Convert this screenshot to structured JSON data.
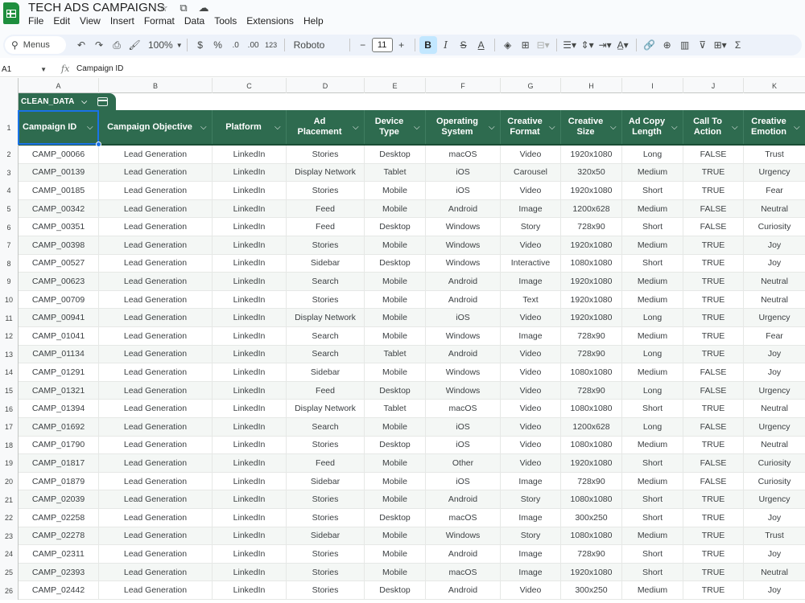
{
  "app": {
    "title": "TECH ADS CAMPAIGNS",
    "menu": [
      "File",
      "Edit",
      "View",
      "Insert",
      "Format",
      "Data",
      "Tools",
      "Extensions",
      "Help"
    ],
    "title_icons": [
      "star-icon",
      "move-folder-icon",
      "cloud-status-icon"
    ]
  },
  "toolbar": {
    "menus_label": "Menus",
    "zoom": "100%",
    "currency": "$",
    "percent": "%",
    "decrease_decimal": ".0",
    "increase_decimal": ".00",
    "more_formats": "123",
    "font": "Roboto",
    "font_size": "11",
    "bold": "B",
    "italic": "I",
    "strike": "S",
    "text_color": "A",
    "sigma": "Σ"
  },
  "formula_bar": {
    "name_box": "A1",
    "fx": "fx",
    "content": "Campaign ID"
  },
  "grid": {
    "column_letters": [
      "A",
      "B",
      "C",
      "D",
      "E",
      "F",
      "G",
      "H",
      "I",
      "J",
      "K"
    ],
    "table_name": "CLEAN_DATA",
    "headers": [
      "Campaign ID",
      "Campaign Objective",
      "Platform",
      "Ad\nPlacement",
      "Device\nType",
      "Operating\nSystem",
      "Creative\nFormat",
      "Creative\nSize",
      "Ad Copy\nLength",
      "Call To\nAction",
      "Creative\nEmotion"
    ],
    "row_numbers": [
      "1",
      "2",
      "3",
      "4",
      "5",
      "6",
      "7",
      "8",
      "9",
      "10",
      "11",
      "12",
      "13",
      "14",
      "15",
      "16",
      "17",
      "18",
      "19",
      "20",
      "21",
      "22",
      "23",
      "24",
      "25",
      "26"
    ],
    "rows": [
      [
        "CAMP_00066",
        "Lead Generation",
        "LinkedIn",
        "Stories",
        "Desktop",
        "macOS",
        "Video",
        "1920x1080",
        "Long",
        "FALSE",
        "Trust"
      ],
      [
        "CAMP_00139",
        "Lead Generation",
        "LinkedIn",
        "Display Network",
        "Tablet",
        "iOS",
        "Carousel",
        "320x50",
        "Medium",
        "TRUE",
        "Urgency"
      ],
      [
        "CAMP_00185",
        "Lead Generation",
        "LinkedIn",
        "Stories",
        "Mobile",
        "iOS",
        "Video",
        "1920x1080",
        "Short",
        "TRUE",
        "Fear"
      ],
      [
        "CAMP_00342",
        "Lead Generation",
        "LinkedIn",
        "Feed",
        "Mobile",
        "Android",
        "Image",
        "1200x628",
        "Medium",
        "FALSE",
        "Neutral"
      ],
      [
        "CAMP_00351",
        "Lead Generation",
        "LinkedIn",
        "Feed",
        "Desktop",
        "Windows",
        "Story",
        "728x90",
        "Short",
        "FALSE",
        "Curiosity"
      ],
      [
        "CAMP_00398",
        "Lead Generation",
        "LinkedIn",
        "Stories",
        "Mobile",
        "Windows",
        "Video",
        "1920x1080",
        "Medium",
        "TRUE",
        "Joy"
      ],
      [
        "CAMP_00527",
        "Lead Generation",
        "LinkedIn",
        "Sidebar",
        "Desktop",
        "Windows",
        "Interactive",
        "1080x1080",
        "Short",
        "TRUE",
        "Joy"
      ],
      [
        "CAMP_00623",
        "Lead Generation",
        "LinkedIn",
        "Search",
        "Mobile",
        "Android",
        "Image",
        "1920x1080",
        "Medium",
        "TRUE",
        "Neutral"
      ],
      [
        "CAMP_00709",
        "Lead Generation",
        "LinkedIn",
        "Stories",
        "Mobile",
        "Android",
        "Text",
        "1920x1080",
        "Medium",
        "TRUE",
        "Neutral"
      ],
      [
        "CAMP_00941",
        "Lead Generation",
        "LinkedIn",
        "Display Network",
        "Mobile",
        "iOS",
        "Video",
        "1920x1080",
        "Long",
        "TRUE",
        "Urgency"
      ],
      [
        "CAMP_01041",
        "Lead Generation",
        "LinkedIn",
        "Search",
        "Mobile",
        "Windows",
        "Image",
        "728x90",
        "Medium",
        "TRUE",
        "Fear"
      ],
      [
        "CAMP_01134",
        "Lead Generation",
        "LinkedIn",
        "Search",
        "Tablet",
        "Android",
        "Video",
        "728x90",
        "Long",
        "TRUE",
        "Joy"
      ],
      [
        "CAMP_01291",
        "Lead Generation",
        "LinkedIn",
        "Sidebar",
        "Mobile",
        "Windows",
        "Video",
        "1080x1080",
        "Medium",
        "FALSE",
        "Joy"
      ],
      [
        "CAMP_01321",
        "Lead Generation",
        "LinkedIn",
        "Feed",
        "Desktop",
        "Windows",
        "Video",
        "728x90",
        "Long",
        "FALSE",
        "Urgency"
      ],
      [
        "CAMP_01394",
        "Lead Generation",
        "LinkedIn",
        "Display Network",
        "Tablet",
        "macOS",
        "Video",
        "1080x1080",
        "Short",
        "TRUE",
        "Neutral"
      ],
      [
        "CAMP_01692",
        "Lead Generation",
        "LinkedIn",
        "Search",
        "Mobile",
        "iOS",
        "Video",
        "1200x628",
        "Long",
        "FALSE",
        "Urgency"
      ],
      [
        "CAMP_01790",
        "Lead Generation",
        "LinkedIn",
        "Stories",
        "Desktop",
        "iOS",
        "Video",
        "1080x1080",
        "Medium",
        "TRUE",
        "Neutral"
      ],
      [
        "CAMP_01817",
        "Lead Generation",
        "LinkedIn",
        "Feed",
        "Mobile",
        "Other",
        "Video",
        "1920x1080",
        "Short",
        "FALSE",
        "Curiosity"
      ],
      [
        "CAMP_01879",
        "Lead Generation",
        "LinkedIn",
        "Sidebar",
        "Mobile",
        "iOS",
        "Image",
        "728x90",
        "Medium",
        "FALSE",
        "Curiosity"
      ],
      [
        "CAMP_02039",
        "Lead Generation",
        "LinkedIn",
        "Stories",
        "Mobile",
        "Android",
        "Story",
        "1080x1080",
        "Short",
        "TRUE",
        "Urgency"
      ],
      [
        "CAMP_02258",
        "Lead Generation",
        "LinkedIn",
        "Stories",
        "Desktop",
        "macOS",
        "Image",
        "300x250",
        "Short",
        "TRUE",
        "Joy"
      ],
      [
        "CAMP_02278",
        "Lead Generation",
        "LinkedIn",
        "Sidebar",
        "Mobile",
        "Windows",
        "Story",
        "1080x1080",
        "Medium",
        "TRUE",
        "Trust"
      ],
      [
        "CAMP_02311",
        "Lead Generation",
        "LinkedIn",
        "Stories",
        "Mobile",
        "Android",
        "Image",
        "728x90",
        "Short",
        "TRUE",
        "Joy"
      ],
      [
        "CAMP_02393",
        "Lead Generation",
        "LinkedIn",
        "Stories",
        "Mobile",
        "macOS",
        "Image",
        "1920x1080",
        "Short",
        "TRUE",
        "Neutral"
      ],
      [
        "CAMP_02442",
        "Lead Generation",
        "LinkedIn",
        "Stories",
        "Desktop",
        "Android",
        "Video",
        "300x250",
        "Medium",
        "TRUE",
        "Joy"
      ]
    ]
  },
  "colors": {
    "header_green": "#2e6b4f",
    "selection_blue": "#1a73e8",
    "band": "#f4f7f5"
  }
}
